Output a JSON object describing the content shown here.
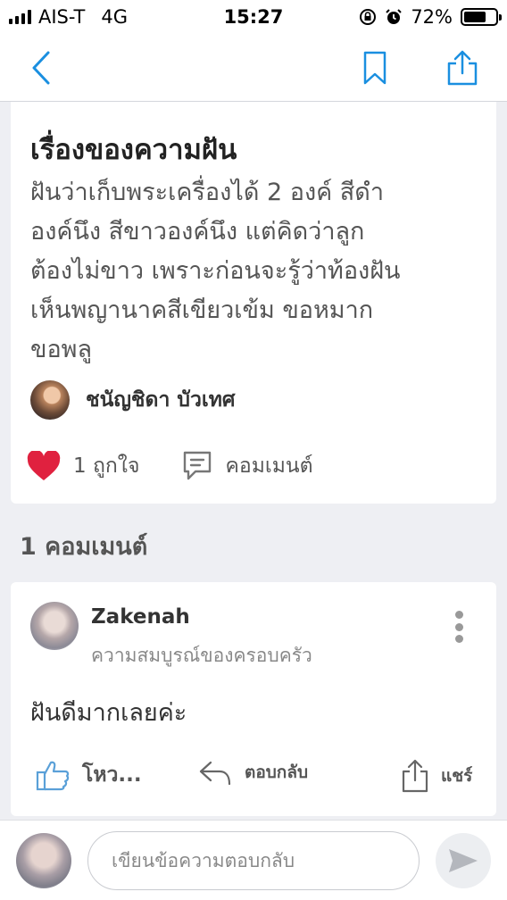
{
  "status_bar": {
    "carrier": "AIS-T",
    "network": "4G",
    "time": "15:27",
    "battery": "72%"
  },
  "nav": {
    "back_icon": "chevron-left-icon",
    "bookmark_icon": "bookmark-icon",
    "share_icon": "share-icon",
    "accent": "#1a8fe0"
  },
  "post": {
    "title": "เรื่องของความฝัน",
    "body": "ฝันว่าเก็บพระเครื่องได้ 2 องค์  สีดำ\nองค์นึง สีขาวองค์นึง แต่คิดว่าลูก\nต้องไม่ขาว เพราะก่อนจะรู้ว่าท้องฝัน\nเห็นพญานาคสีเขียวเข้ม ขอหมาก\nขอพลู",
    "author": "ชนัญชิดา บัวเทศ",
    "like_count_label": "1 ถูกใจ",
    "comment_label": "คอมเมนต์",
    "like_color": "#e0213f"
  },
  "comments_heading": "1 คอมเมนต์",
  "comment": {
    "user": "Zakenah",
    "group": "ความสมบูรณ์ของครอบครัว",
    "text": "ฝันดีมากเลยค่ะ",
    "vote_label": "โหว...",
    "reply_label": "ตอบกลับ",
    "share_label": "แชร์"
  },
  "reply_bar": {
    "placeholder": "เขียนข้อความตอบกลับ"
  }
}
